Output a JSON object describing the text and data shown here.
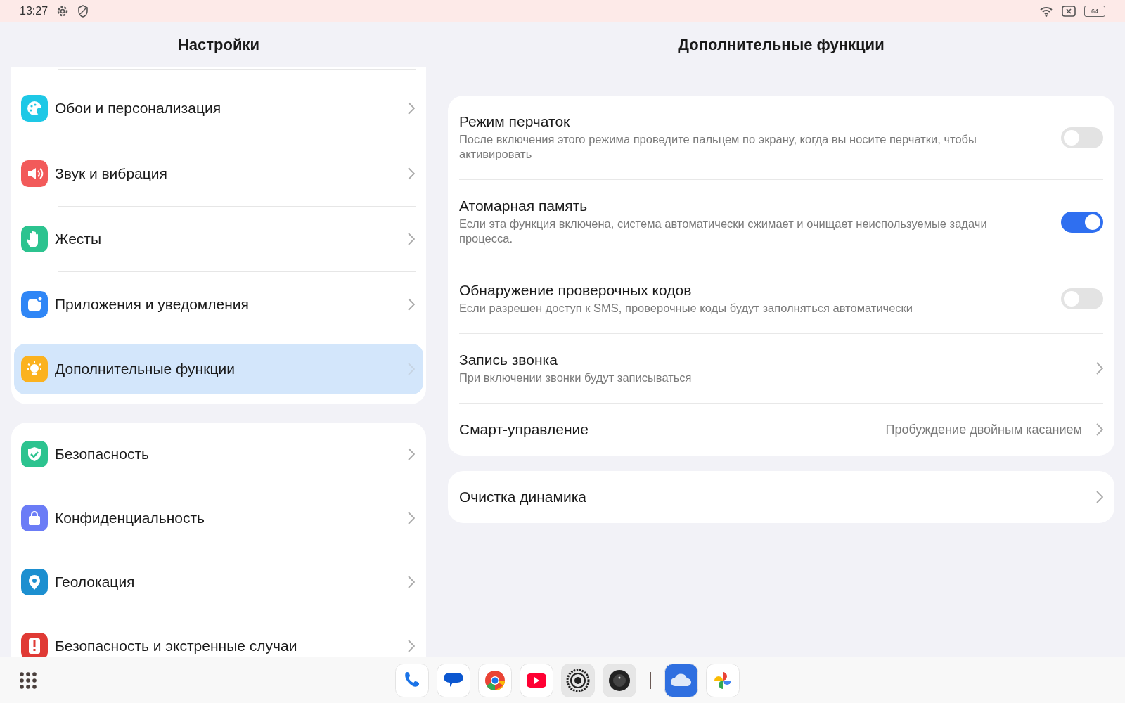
{
  "status_bar": {
    "time": "13:27",
    "battery": "64"
  },
  "sidebar": {
    "title": "Настройки",
    "groups": [
      {
        "items": [
          {
            "label": "Обои и персонализация",
            "color": "#1ec8e6",
            "selected": false
          },
          {
            "label": "Звук и вибрация",
            "color": "#f25a5a",
            "selected": false
          },
          {
            "label": "Жесты",
            "color": "#2cc38f",
            "selected": false
          },
          {
            "label": "Приложения и уведомления",
            "color": "#2f86f6",
            "selected": false
          },
          {
            "label": "Дополнительные функции",
            "color": "#fbb21f",
            "selected": true
          }
        ]
      },
      {
        "items": [
          {
            "label": "Безопасность",
            "color": "#2cc38f",
            "selected": false
          },
          {
            "label": "Конфиденциальность",
            "color": "#6b7cf6",
            "selected": false
          },
          {
            "label": "Геолокация",
            "color": "#1c8fd0",
            "selected": false
          },
          {
            "label": "Безопасность и экстренные случаи",
            "color": "#e03a35",
            "selected": false
          }
        ]
      }
    ]
  },
  "detail": {
    "title": "Дополнительные функции",
    "sections": [
      {
        "rows": [
          {
            "kind": "toggle",
            "title": "Режим перчаток",
            "description": "После включения этого режима проведите пальцем по экрану, когда вы носите перчатки, чтобы активировать",
            "on": false
          },
          {
            "kind": "toggle",
            "title": "Атомарная память",
            "description": "Если эта функция включена, система автоматически сжимает и очищает неиспользуемые задачи процесса.",
            "on": true
          },
          {
            "kind": "toggle",
            "title": "Обнаружение проверочных кодов",
            "description": "Если разрешен доступ к SMS, проверочные коды будут заполняться автоматически",
            "on": false
          },
          {
            "kind": "link",
            "title": "Запись звонка",
            "description": "При включении звонки будут записываться"
          },
          {
            "kind": "link",
            "title": "Смарт-управление",
            "value": "Пробуждение двойным касанием"
          }
        ]
      },
      {
        "rows": [
          {
            "kind": "link",
            "title": "Очистка динамика"
          }
        ]
      }
    ]
  }
}
